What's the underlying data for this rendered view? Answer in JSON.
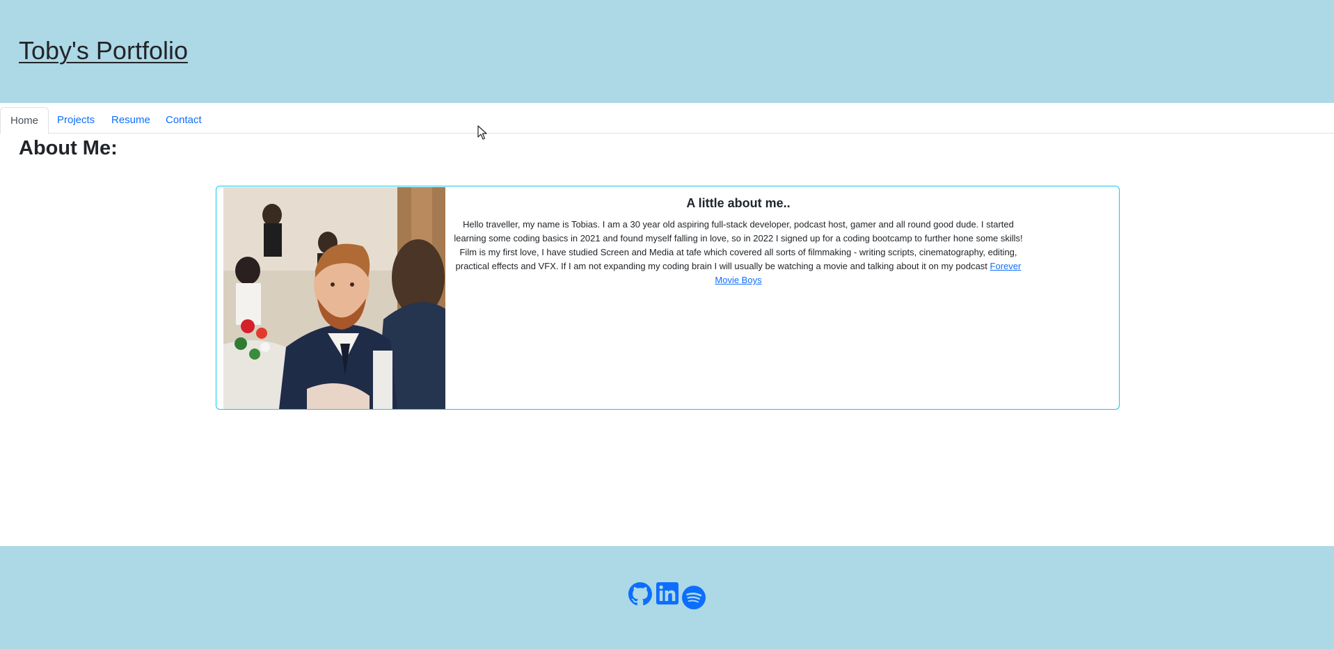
{
  "header": {
    "title": "Toby's Portfolio"
  },
  "nav": {
    "tabs": [
      {
        "label": "Home",
        "active": true
      },
      {
        "label": "Projects"
      },
      {
        "label": "Resume"
      },
      {
        "label": "Contact"
      }
    ]
  },
  "main": {
    "heading": "About Me:",
    "card": {
      "title": "A little about me..",
      "text": "Hello traveller, my name is Tobias. I am a 30 year old aspiring full-stack developer, podcast host, gamer and all round good dude. I started learning some coding basics in 2021 and found myself falling in love, so in 2022 I signed up for a coding bootcamp to further hone some skills! Film is my first love, I have studied Screen and Media at tafe which covered all sorts of filmmaking - writing scripts, cinematography, editing, practical effects and VFX. If I am not expanding my coding brain I will usually be watching a movie and talking about it on my podcast ",
      "link_label": "Forever Movie Boys"
    }
  },
  "footer": {
    "icons": [
      "github-icon",
      "linkedin-icon",
      "spotify-icon"
    ]
  },
  "colors": {
    "banner": "#add8e6",
    "link": "#0d6efd",
    "card_border": "#0dcaf0"
  }
}
